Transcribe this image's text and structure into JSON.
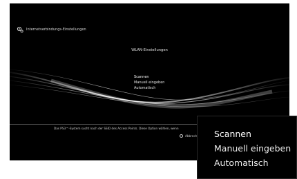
{
  "header": {
    "title": "Internetverbindungs-Einstellungen",
    "icon": "network-settings-icon"
  },
  "subtitle": "WLAN-Einstellungen",
  "menu": {
    "items": [
      {
        "label": "Scannen",
        "selected": true
      },
      {
        "label": "Manuell eingeben",
        "selected": false
      },
      {
        "label": "Automatisch",
        "selected": false
      }
    ]
  },
  "footer": {
    "hint": "Das PS3™-System sucht nach der SSID des Access Points. Diese Option wählen, wenn",
    "cancel_label": "Abbreche",
    "cancel_icon": "circle-button-icon"
  },
  "zoom": {
    "items": [
      {
        "label": "Scannen"
      },
      {
        "label": "Manuell eingeben"
      },
      {
        "label": "Automatisch"
      }
    ]
  },
  "colors": {
    "background": "#000000",
    "text": "#e6e6e6",
    "wave": "#ffffff"
  }
}
